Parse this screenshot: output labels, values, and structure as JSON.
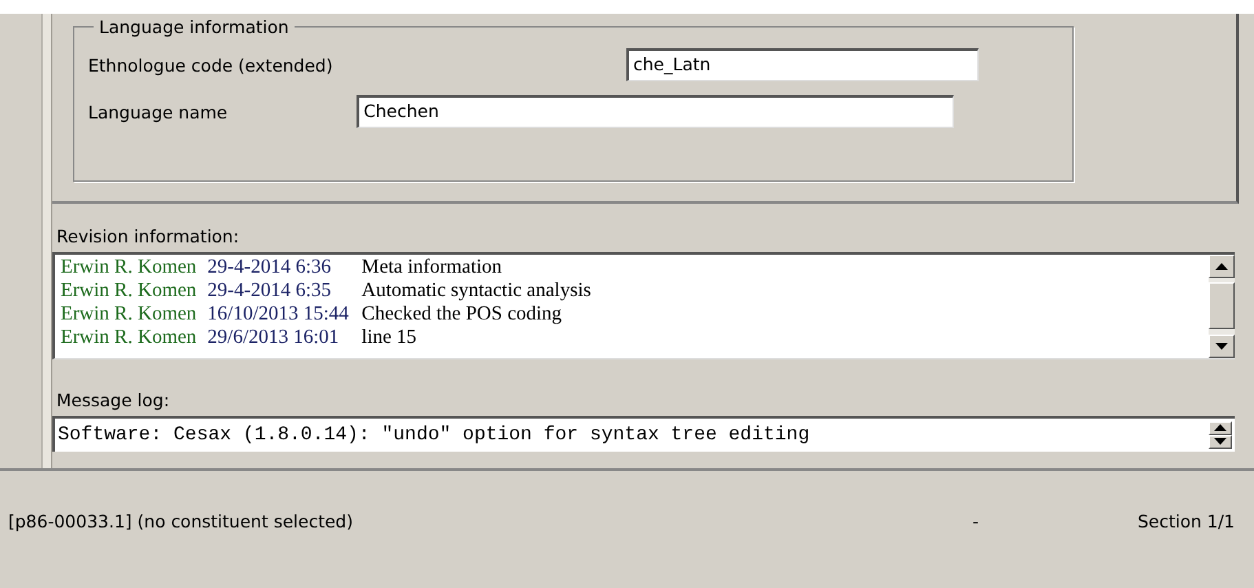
{
  "language_info": {
    "title": "Language information",
    "fields": [
      {
        "label": "Ethnologue code (extended)",
        "value": "che_Latn",
        "kind": "wide"
      },
      {
        "label": "Language name",
        "value": "Chechen",
        "kind": "narrow"
      }
    ]
  },
  "revision": {
    "label": "Revision information:",
    "rows": [
      {
        "author": "Erwin R. Komen",
        "date": "29-4-2014 6:36",
        "description": "Meta information"
      },
      {
        "author": "Erwin R. Komen",
        "date": "29-4-2014 6:35",
        "description": "Automatic syntactic analysis"
      },
      {
        "author": "Erwin R. Komen",
        "date": "16/10/2013 15:44",
        "description": "Checked the POS coding"
      },
      {
        "author": "Erwin R. Komen",
        "date": "29/6/2013 16:01",
        "description": "line 15"
      }
    ]
  },
  "message_log": {
    "label": "Message log:",
    "value": "Software: Cesax (1.8.0.14): \"undo\" option for syntax tree editing"
  },
  "status_bar": {
    "location": "[p86-00033.1] (no constituent selected)",
    "middle": "-",
    "section": "Section 1/1"
  }
}
